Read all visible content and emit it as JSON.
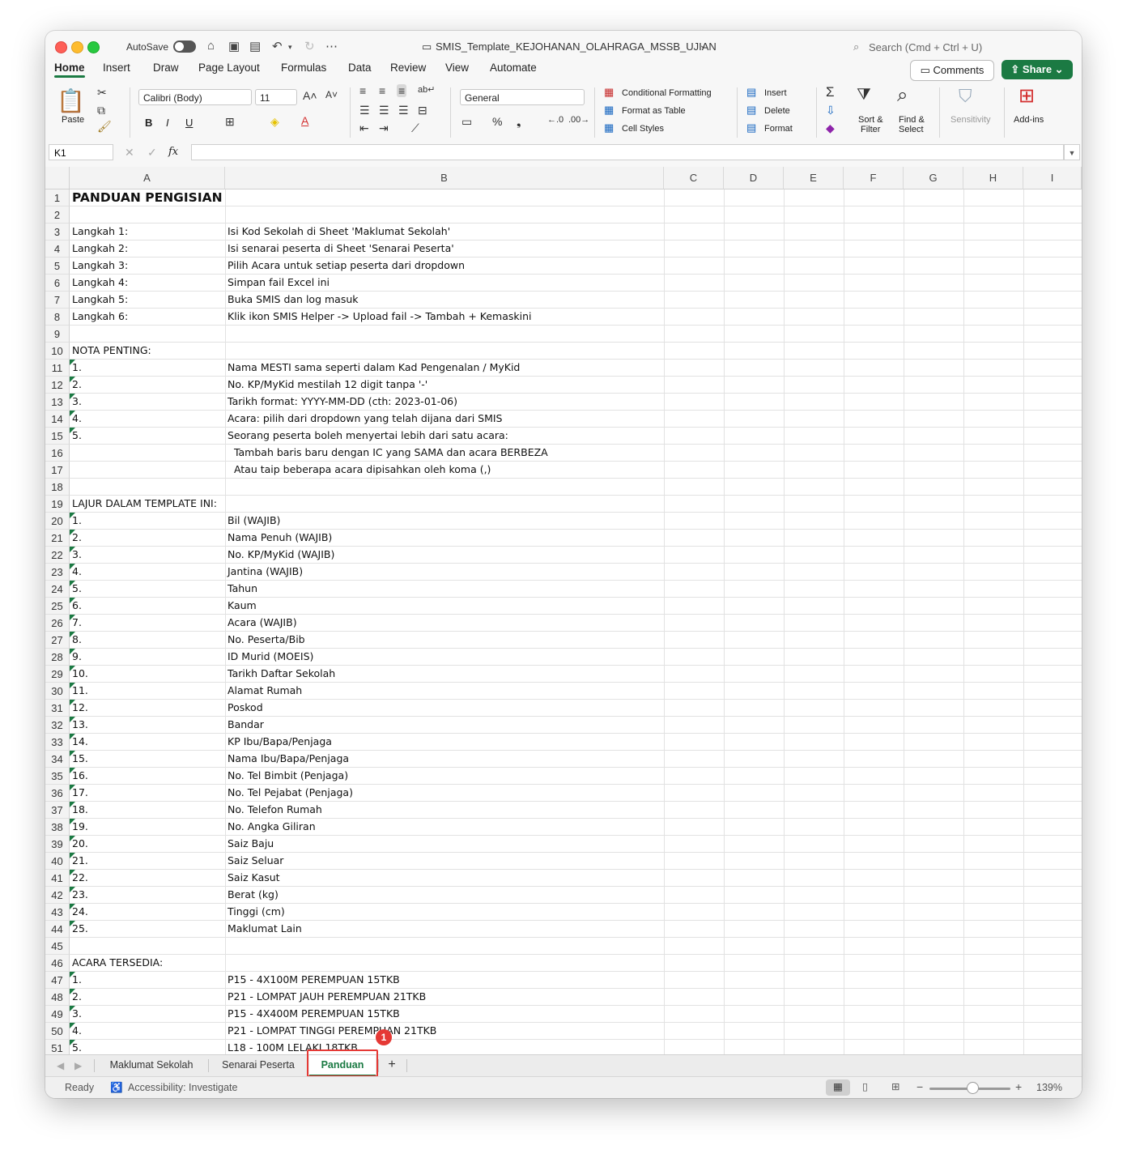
{
  "titlebar": {
    "autosave_label": "AutoSave",
    "doc_title": "SMIS_Template_KEJOHANAN_OLAHRAGA_MSSB_UJIAN",
    "search_placeholder": "Search (Cmd + Ctrl + U)"
  },
  "menu": {
    "tabs": [
      "Home",
      "Insert",
      "Draw",
      "Page Layout",
      "Formulas",
      "Data",
      "Review",
      "View",
      "Automate"
    ],
    "comments": "Comments",
    "share": "Share"
  },
  "ribbon": {
    "paste": "Paste",
    "font_name": "Calibri (Body)",
    "font_size": "11",
    "bold": "B",
    "italic": "I",
    "underline": "U",
    "number_format": "General",
    "conditional_formatting": "Conditional Formatting",
    "format_as_table": "Format as Table",
    "cell_styles": "Cell Styles",
    "insert": "Insert",
    "delete": "Delete",
    "format": "Format",
    "sort_filter": "Sort &",
    "sort_filter2": "Filter",
    "find_select": "Find &",
    "find_select2": "Select",
    "sensitivity": "Sensitivity",
    "addins": "Add-ins"
  },
  "formula_bar": {
    "name_box": "K1",
    "fx": "fx",
    "content": ""
  },
  "columns": [
    "A",
    "B",
    "C",
    "D",
    "E",
    "F",
    "G",
    "H",
    "I"
  ],
  "rows": [
    {
      "n": "1",
      "a": "PANDUAN PENGISIAN",
      "b": ""
    },
    {
      "n": "2",
      "a": "",
      "b": ""
    },
    {
      "n": "3",
      "a": "Langkah 1:",
      "b": "Isi Kod Sekolah di Sheet 'Maklumat Sekolah'"
    },
    {
      "n": "4",
      "a": "Langkah 2:",
      "b": "Isi senarai peserta di Sheet 'Senarai Peserta'"
    },
    {
      "n": "5",
      "a": "Langkah 3:",
      "b": "Pilih Acara untuk setiap peserta dari dropdown"
    },
    {
      "n": "6",
      "a": "Langkah 4:",
      "b": "Simpan fail Excel ini"
    },
    {
      "n": "7",
      "a": "Langkah 5:",
      "b": "Buka SMIS dan log masuk"
    },
    {
      "n": "8",
      "a": "Langkah 6:",
      "b": "Klik ikon SMIS Helper -> Upload fail -> Tambah + Kemaskini"
    },
    {
      "n": "9",
      "a": "",
      "b": ""
    },
    {
      "n": "10",
      "a": "NOTA PENTING:",
      "b": ""
    },
    {
      "n": "11",
      "a": "1.",
      "b": "Nama MESTI sama seperti dalam Kad Pengenalan / MyKid"
    },
    {
      "n": "12",
      "a": "2.",
      "b": "No. KP/MyKid mestilah 12 digit tanpa '-'"
    },
    {
      "n": "13",
      "a": "3.",
      "b": "Tarikh format: YYYY-MM-DD (cth: 2023-01-06)"
    },
    {
      "n": "14",
      "a": "4.",
      "b": "Acara: pilih dari dropdown yang telah dijana dari SMIS"
    },
    {
      "n": "15",
      "a": "5.",
      "b": "Seorang peserta boleh menyertai lebih dari satu acara:"
    },
    {
      "n": "16",
      "a": "",
      "b": "  Tambah baris baru dengan IC yang SAMA dan acara BERBEZA"
    },
    {
      "n": "17",
      "a": "",
      "b": "  Atau taip beberapa acara dipisahkan oleh koma (,)"
    },
    {
      "n": "18",
      "a": "",
      "b": ""
    },
    {
      "n": "19",
      "a": "LAJUR DALAM TEMPLATE INI:",
      "b": ""
    },
    {
      "n": "20",
      "a": "1.",
      "b": "Bil (WAJIB)"
    },
    {
      "n": "21",
      "a": "2.",
      "b": "Nama Penuh (WAJIB)"
    },
    {
      "n": "22",
      "a": "3.",
      "b": "No. KP/MyKid (WAJIB)"
    },
    {
      "n": "23",
      "a": "4.",
      "b": "Jantina (WAJIB)"
    },
    {
      "n": "24",
      "a": "5.",
      "b": "Tahun"
    },
    {
      "n": "25",
      "a": "6.",
      "b": "Kaum"
    },
    {
      "n": "26",
      "a": "7.",
      "b": "Acara (WAJIB)"
    },
    {
      "n": "27",
      "a": "8.",
      "b": "No. Peserta/Bib"
    },
    {
      "n": "28",
      "a": "9.",
      "b": "ID Murid (MOEIS)"
    },
    {
      "n": "29",
      "a": "10.",
      "b": "Tarikh Daftar Sekolah"
    },
    {
      "n": "30",
      "a": "11.",
      "b": "Alamat Rumah"
    },
    {
      "n": "31",
      "a": "12.",
      "b": "Poskod"
    },
    {
      "n": "32",
      "a": "13.",
      "b": "Bandar"
    },
    {
      "n": "33",
      "a": "14.",
      "b": "KP Ibu/Bapa/Penjaga"
    },
    {
      "n": "34",
      "a": "15.",
      "b": "Nama Ibu/Bapa/Penjaga"
    },
    {
      "n": "35",
      "a": "16.",
      "b": "No. Tel Bimbit (Penjaga)"
    },
    {
      "n": "36",
      "a": "17.",
      "b": "No. Tel Pejabat (Penjaga)"
    },
    {
      "n": "37",
      "a": "18.",
      "b": "No. Telefon Rumah"
    },
    {
      "n": "38",
      "a": "19.",
      "b": "No. Angka Giliran"
    },
    {
      "n": "39",
      "a": "20.",
      "b": "Saiz Baju"
    },
    {
      "n": "40",
      "a": "21.",
      "b": "Saiz Seluar"
    },
    {
      "n": "41",
      "a": "22.",
      "b": "Saiz Kasut"
    },
    {
      "n": "42",
      "a": "23.",
      "b": "Berat (kg)"
    },
    {
      "n": "43",
      "a": "24.",
      "b": "Tinggi (cm)"
    },
    {
      "n": "44",
      "a": "25.",
      "b": "Maklumat Lain"
    },
    {
      "n": "45",
      "a": "",
      "b": ""
    },
    {
      "n": "46",
      "a": "ACARA TERSEDIA:",
      "b": ""
    },
    {
      "n": "47",
      "a": "1.",
      "b": "P15 - 4X100M PEREMPUAN 15TKB"
    },
    {
      "n": "48",
      "a": "2.",
      "b": "P21 - LOMPAT JAUH PEREMPUAN 21TKB"
    },
    {
      "n": "49",
      "a": "3.",
      "b": "P15 - 4X400M PEREMPUAN 15TKB"
    },
    {
      "n": "50",
      "a": "4.",
      "b": "P21 - LOMPAT TINGGI PEREMPUAN 21TKB"
    },
    {
      "n": "51",
      "a": "5.",
      "b": "L18 - 100M LELAKI 18TKB"
    }
  ],
  "sheet_tabs": [
    "Maklumat Sekolah",
    "Senarai Peserta",
    "Panduan"
  ],
  "add_sheet": "+",
  "marker": "1",
  "status": {
    "ready": "Ready",
    "accessibility": "Accessibility: Investigate",
    "zoom": "139%"
  }
}
